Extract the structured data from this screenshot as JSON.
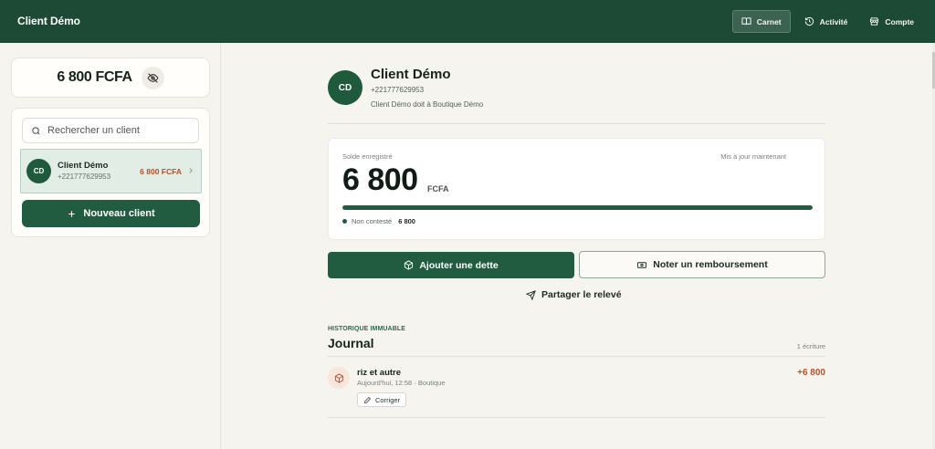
{
  "header": {
    "app_title": "Client Démo",
    "nav": [
      {
        "label": "Carnet",
        "icon": "book-icon",
        "active": true
      },
      {
        "label": "Activité",
        "icon": "history-icon",
        "active": false
      },
      {
        "label": "Compte",
        "icon": "store-icon",
        "active": false
      }
    ]
  },
  "sidebar": {
    "balance": "6 800 FCFA",
    "visibility_icon": "eye-off-icon",
    "search": {
      "placeholder": "Rechercher un client"
    },
    "clients": [
      {
        "initials": "CD",
        "name": "Client Démo",
        "phone": "+221777629953",
        "amount": "6 800 FCFA"
      }
    ],
    "new_client_label": "Nouveau client"
  },
  "client": {
    "initials": "CD",
    "name": "Client Démo",
    "phone": "+221777629953",
    "owes_text": "Client Démo doit à Boutique Démo"
  },
  "solde": {
    "label": "Solde enregistré",
    "updated": "Mis à jour maintenant",
    "value": "6 800",
    "unit": "FCFA",
    "uncontested_fraction": 1.0,
    "legend_label": "Non contesté",
    "legend_value": "6 800"
  },
  "actions": {
    "add_debt": "Ajouter une dette",
    "note_repayment": "Noter un remboursement",
    "share": "Partager le relevé"
  },
  "journal": {
    "kicker": "HISTORIQUE IMMUABLE",
    "title": "Journal",
    "count": "1 écriture",
    "entries": [
      {
        "title": "riz et autre",
        "meta": "Aujourd'hui, 12:58 · Boutique",
        "amount": "+6 800",
        "correct_label": "Corriger"
      }
    ]
  },
  "colors": {
    "brand": "#1d4a34",
    "primary": "#225c40",
    "debt": "#b8502a"
  }
}
